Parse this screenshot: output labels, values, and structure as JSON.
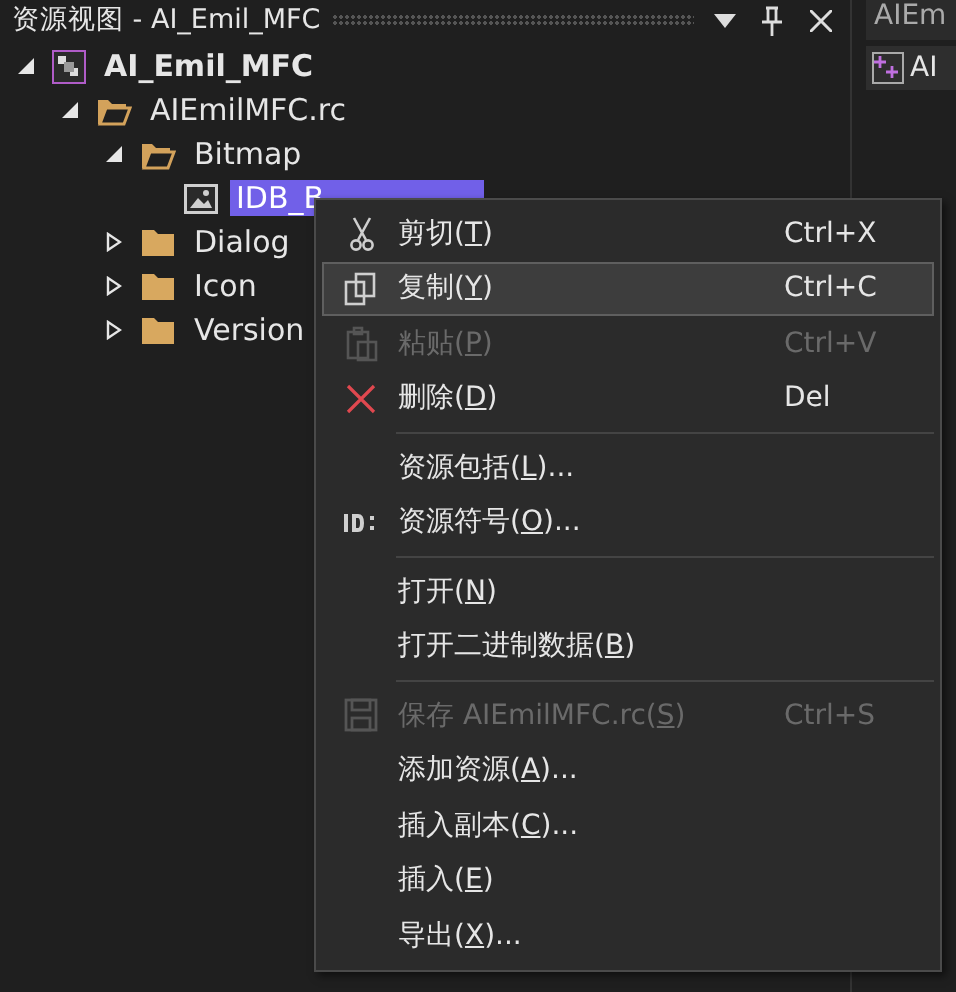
{
  "panel": {
    "title": "资源视图 - AI_Emil_MFC"
  },
  "tree": [
    {
      "label": "AI_Emil_MFC",
      "kind": "project",
      "expanded": true,
      "selected": false,
      "children": [
        {
          "label": "AIEmilMFC.rc",
          "kind": "folder",
          "expanded": true,
          "selected": false,
          "children": [
            {
              "label": "Bitmap",
              "kind": "folder",
              "expanded": true,
              "selected": false,
              "children": [
                {
                  "label": "IDB_B",
                  "kind": "bitmap",
                  "selected": true
                }
              ]
            },
            {
              "label": "Dialog",
              "kind": "folder",
              "expanded": false,
              "selected": false
            },
            {
              "label": "Icon",
              "kind": "folder",
              "expanded": false,
              "selected": false
            },
            {
              "label": "Version",
              "kind": "folder",
              "expanded": false,
              "selected": false
            }
          ]
        }
      ]
    }
  ],
  "side_panel": {
    "tab": "AIEm",
    "item": "AI"
  },
  "context_menu": [
    {
      "kind": "item",
      "before": "剪切(",
      "mnemonic": "T",
      "after": ")",
      "shortcut": "Ctrl+X",
      "selected": false,
      "disabled": false
    },
    {
      "kind": "item",
      "before": "复制(",
      "mnemonic": "Y",
      "after": ")",
      "shortcut": "Ctrl+C",
      "selected": true,
      "disabled": false
    },
    {
      "kind": "item",
      "before": "粘贴(",
      "mnemonic": "P",
      "after": ")",
      "shortcut": "Ctrl+V",
      "selected": false,
      "disabled": true
    },
    {
      "kind": "item",
      "before": "删除(",
      "mnemonic": "D",
      "after": ")",
      "shortcut": "Del",
      "selected": false,
      "disabled": false
    },
    {
      "kind": "separator"
    },
    {
      "kind": "item",
      "before": "资源包括(",
      "mnemonic": "L",
      "after": ")...",
      "selected": false,
      "disabled": false
    },
    {
      "kind": "item",
      "before": "资源符号(",
      "mnemonic": "O",
      "after": ")...",
      "selected": false,
      "disabled": false
    },
    {
      "kind": "separator"
    },
    {
      "kind": "item",
      "before": "打开(",
      "mnemonic": "N",
      "after": ")",
      "selected": false,
      "disabled": false
    },
    {
      "kind": "item",
      "before": "打开二进制数据(",
      "mnemonic": "B",
      "after": ")",
      "selected": false,
      "disabled": false
    },
    {
      "kind": "separator"
    },
    {
      "kind": "item",
      "before": "保存 AIEmilMFC.rc(",
      "mnemonic": "S",
      "after": ")",
      "shortcut": "Ctrl+S",
      "selected": false,
      "disabled": true
    },
    {
      "kind": "item",
      "before": "添加资源(",
      "mnemonic": "A",
      "after": ")...",
      "selected": false,
      "disabled": false
    },
    {
      "kind": "item",
      "before": "插入副本(",
      "mnemonic": "C",
      "after": ")...",
      "selected": false,
      "disabled": false
    },
    {
      "kind": "item",
      "before": "插入(",
      "mnemonic": "E",
      "after": ")",
      "selected": false,
      "disabled": false
    },
    {
      "kind": "item",
      "before": "导出(",
      "mnemonic": "X",
      "after": ")...",
      "selected": false,
      "disabled": false
    }
  ]
}
